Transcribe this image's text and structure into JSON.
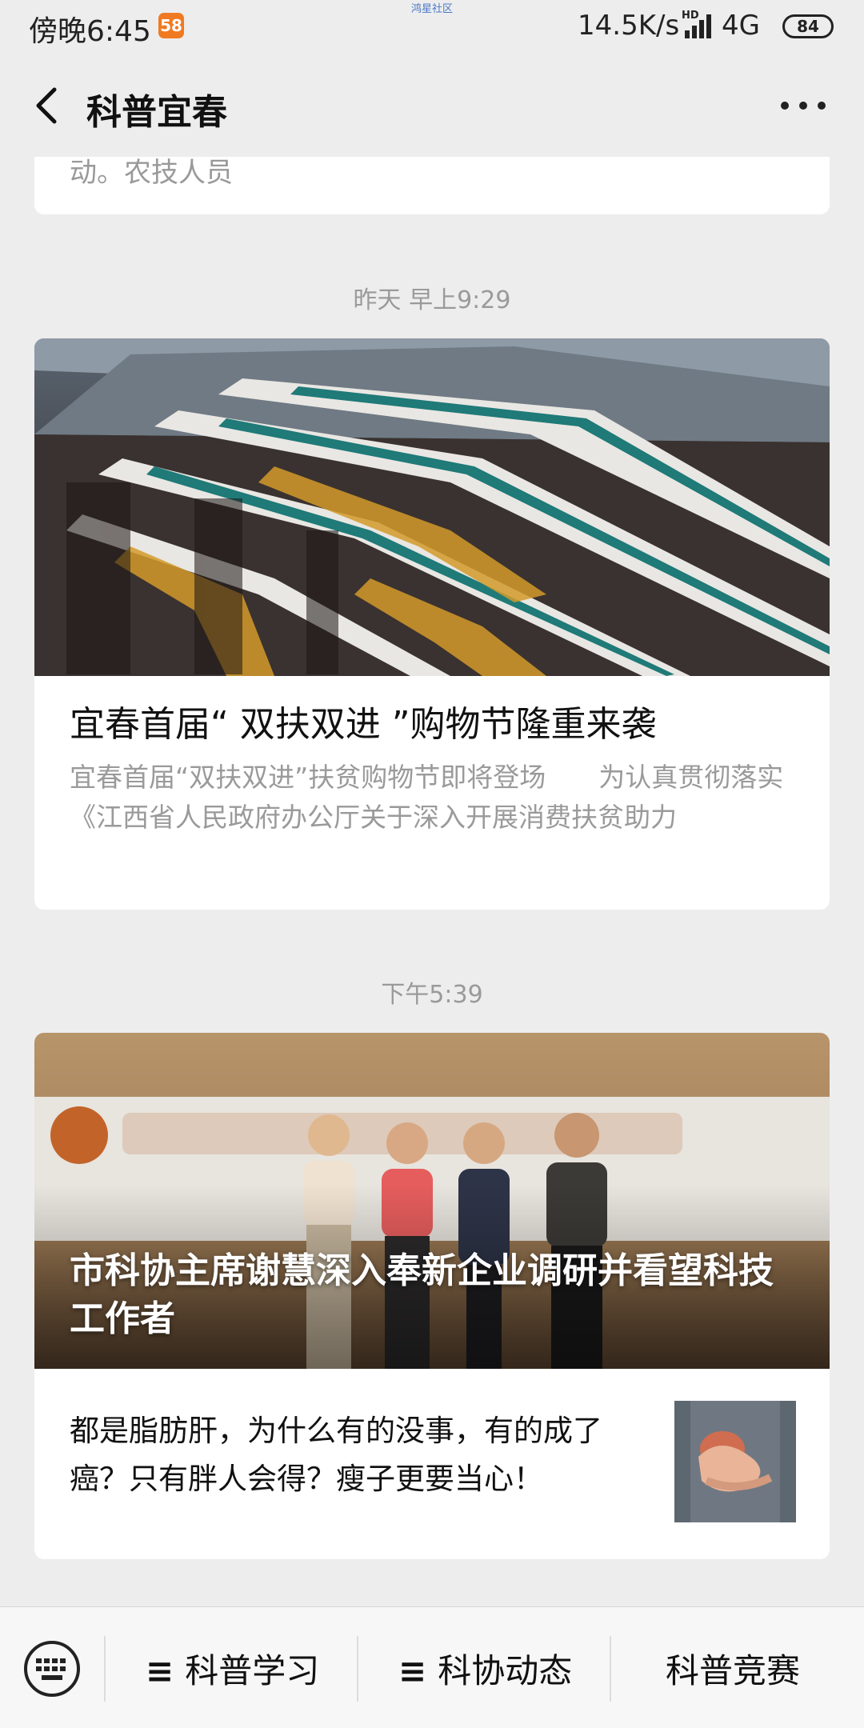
{
  "status_bar": {
    "time": "傍晚6:45",
    "app_icon_text": "58",
    "watermark": "鸿星社区",
    "net_speed": "14.5K/s",
    "hd": "HD",
    "network": "4G",
    "battery": "84"
  },
  "nav": {
    "title": "科普宜春"
  },
  "feed": {
    "partial_card_text": "动。农技人员",
    "time_1": "昨天 早上9:29",
    "article_1": {
      "title": "宜春首届“ 双扶双进 ”购物节隆重来袭",
      "desc": "宜春首届“双扶双进”扶贫购物节即将登场　　为认真贯彻落实《江西省人民政府办公厅关于深入开展消费扶贫助力"
    },
    "time_2": "下午5:39",
    "article_2": {
      "headline": "市科协主席谢慧深入奉新企业调研并看望科技工作者",
      "sub": "都是脂肪肝，为什么有的没事，有的成了癌？只有胖人会得？瘦子更要当心！"
    }
  },
  "bottom_menu": {
    "items": [
      {
        "label": "科普学习",
        "prefix": "≡"
      },
      {
        "label": "科协动态",
        "prefix": "≡"
      },
      {
        "label": "科普竞赛",
        "prefix": ""
      }
    ]
  },
  "colors": {
    "background": "#ededed",
    "card": "#ffffff",
    "timestamp": "#9a9a9a",
    "app_icon": "#f07a22"
  }
}
